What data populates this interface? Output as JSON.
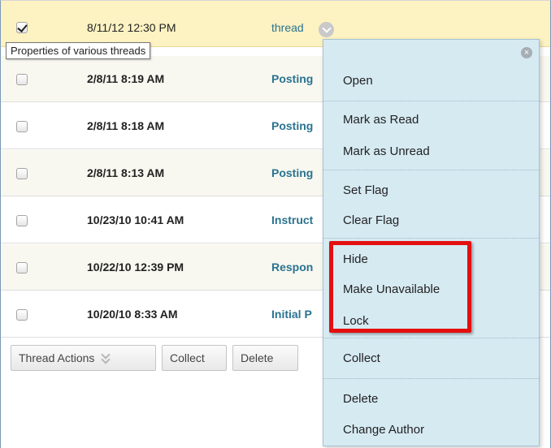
{
  "tooltip": "Properties of various threads",
  "rows": [
    {
      "date": "8/11/12 12:30 PM",
      "title": "thread",
      "checked": true
    },
    {
      "date": "2/8/11 8:19 AM",
      "title": "Posting"
    },
    {
      "date": "2/8/11 8:18 AM",
      "title": "Posting"
    },
    {
      "date": "2/8/11 8:13 AM",
      "title": "Posting"
    },
    {
      "date": "10/23/10 10:41 AM",
      "title": "Instruct"
    },
    {
      "date": "10/22/10 12:39 PM",
      "title": "Respon"
    },
    {
      "date": "10/20/10 8:33 AM",
      "title": "Initial P"
    }
  ],
  "actions": {
    "thread_actions": "Thread Actions",
    "collect": "Collect",
    "delete": "Delete"
  },
  "menu": {
    "close_glyph": "×",
    "items": [
      {
        "label": "Open"
      },
      {
        "label": "Mark as Read"
      },
      {
        "label": "Mark as Unread"
      },
      {
        "label": "Set Flag"
      },
      {
        "label": "Clear Flag"
      },
      {
        "label": "Hide"
      },
      {
        "label": "Make Unavailable"
      },
      {
        "label": "Lock"
      },
      {
        "label": "Collect"
      },
      {
        "label": "Delete"
      },
      {
        "label": "Change Author"
      }
    ]
  },
  "colors": {
    "selected_row": "#fdf2c2",
    "title_link": "#2a7390",
    "menu_bg": "#d6eaf2",
    "highlight": "#e40f0f"
  }
}
